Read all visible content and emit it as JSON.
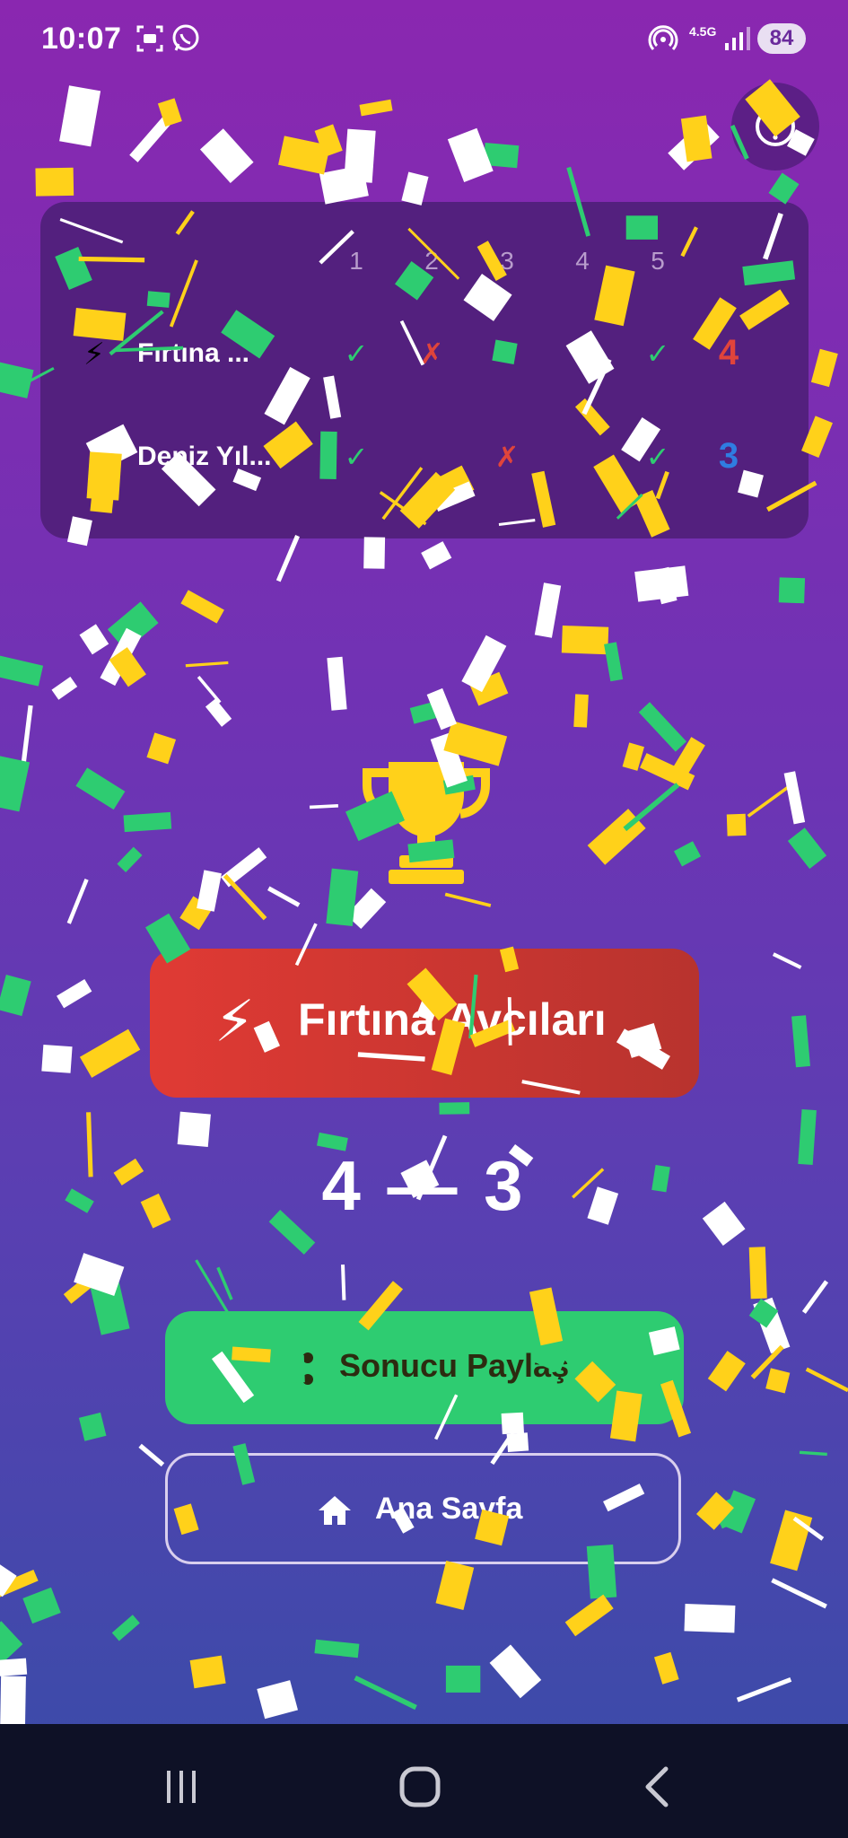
{
  "status_bar": {
    "time": "10:07",
    "network": "4.5G",
    "battery": "84",
    "icons": [
      "screenshot-icon",
      "whatsapp-icon",
      "hotspot-icon",
      "signal-icon"
    ]
  },
  "help": {
    "icon": "question-icon"
  },
  "scoreboard": {
    "rounds": [
      "1",
      "2",
      "3",
      "4",
      "5"
    ],
    "players": [
      {
        "emoji": "⚡",
        "name": "Fırtına ...",
        "marks": [
          "✓",
          "✗",
          "✓",
          "✓",
          "✓"
        ],
        "results": [
          "win",
          "loss",
          "win",
          "win",
          "win"
        ],
        "score": "4",
        "score_color": "#e0443b"
      },
      {
        "emoji": "🔥",
        "name": "Deniz Yıl...",
        "marks": [
          "✓",
          "",
          "✗",
          "",
          "✓"
        ],
        "results": [
          "win",
          "",
          "loss",
          "",
          "win"
        ],
        "score": "3",
        "score_color": "#2f7de1"
      }
    ]
  },
  "result": {
    "trophy_icon": "trophy-icon",
    "winner_emoji": "⚡",
    "winner_name": "Fırtına Avcıları",
    "score_left": "4",
    "separator": "—",
    "score_right": "3"
  },
  "actions": {
    "share_label": "Sonucu Paylaş",
    "share_icon": "share-icon",
    "home_label": "Ana Sayfa",
    "home_icon": "home-icon"
  },
  "colors": {
    "accent_green": "#2ecc71",
    "loss_red": "#e0443b",
    "banner_red": "#d9362f",
    "trophy_gold": "#ffd11a",
    "confetti": [
      "#ffffff",
      "#ffd11a",
      "#2ecc71"
    ]
  }
}
